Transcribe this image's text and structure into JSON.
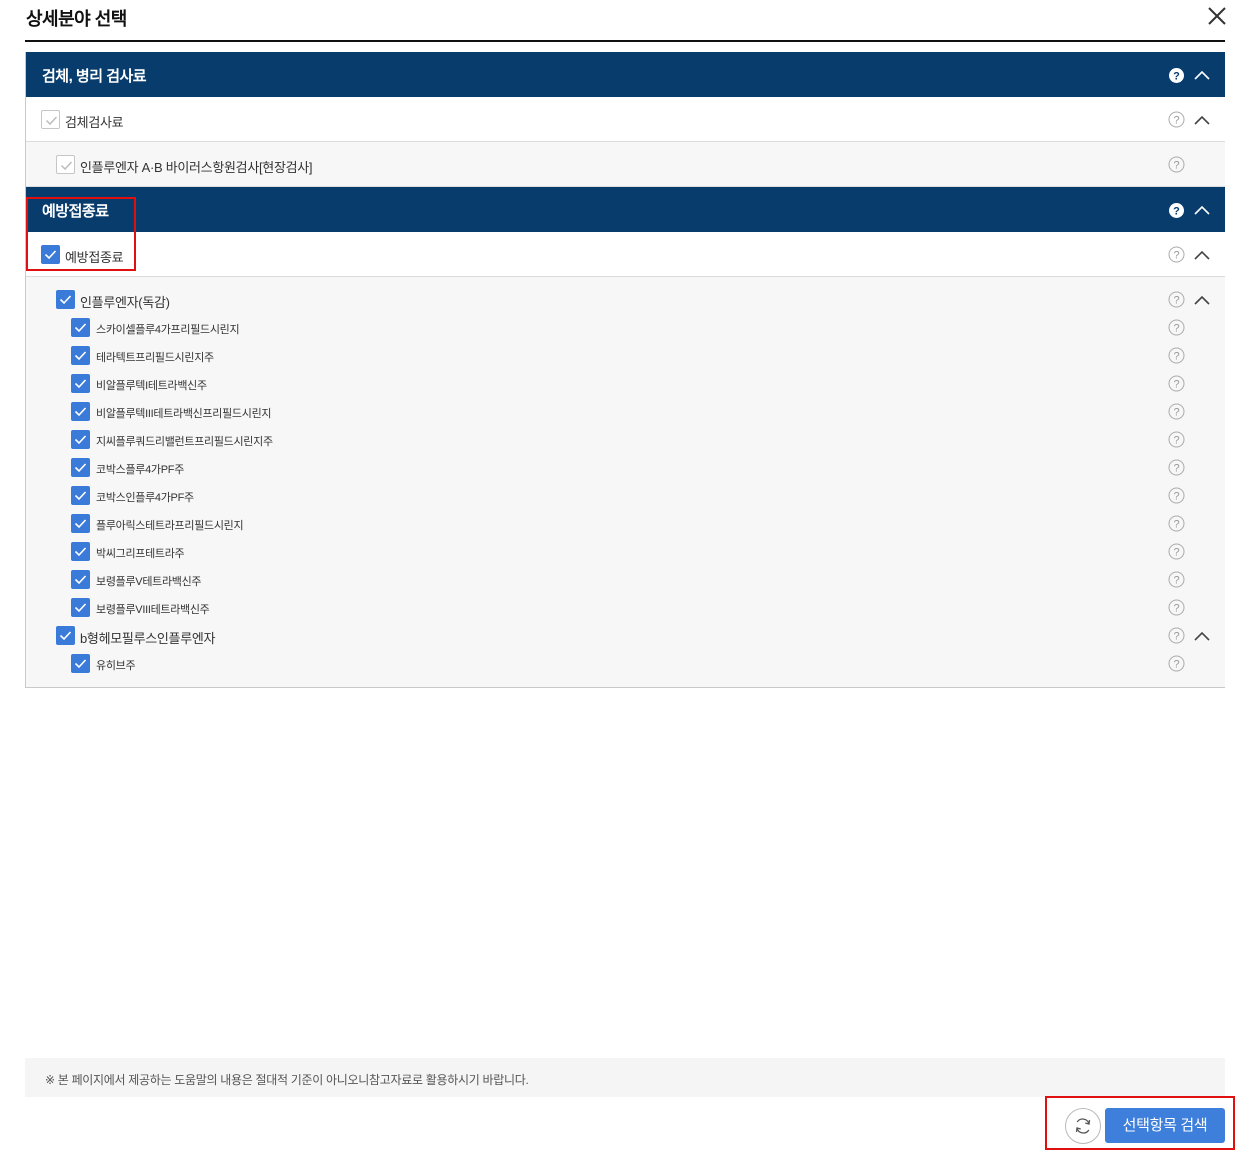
{
  "modal": {
    "title": "상세분야 선택",
    "close_icon": "close-icon"
  },
  "categories": [
    {
      "label": "검체, 병리 검사료",
      "expanded": true,
      "subs": [
        {
          "label": "검체검사료",
          "checked": false,
          "expanded": true,
          "items": [
            {
              "label": "인플루엔자 A·B 바이러스항원검사[현장검사]",
              "checked": false
            }
          ]
        }
      ]
    },
    {
      "label": "예방접종료",
      "expanded": true,
      "subs": [
        {
          "label": "예방접종료",
          "checked": true,
          "expanded": true,
          "groups": [
            {
              "label": "인플루엔자(독감)",
              "checked": true,
              "items": [
                "스카이셀플루4가프리필드시린지",
                "테라텍트프리필드시린지주",
                "비알플루텍I테트라백신주",
                "비알플루텍III테트라백신프리필드시린지",
                "지씨플루쿼드리밸런트프리필드시린지주",
                "코박스플루4가PF주",
                "코박스인플루4가PF주",
                "플루아릭스테트라프리필드시린지",
                "박씨그리프테트라주",
                "보령플루V테트라백신주",
                "보령플루VIII테트라백신주"
              ]
            },
            {
              "label": "b형헤모필루스인플루엔자",
              "checked": true,
              "items": [
                "유히브주"
              ]
            }
          ]
        }
      ]
    }
  ],
  "footer": {
    "notice": "※ 본 페이지에서 제공하는 도움말의 내용은 절대적 기준이 아니오니참고자료로 활용하시기 바랍니다.",
    "refresh_icon": "refresh-icon",
    "search_button": "선택항목 검색"
  },
  "colors": {
    "category_header": "#073c6d",
    "checkbox_checked": "#3a7ad9",
    "search_button": "#3d7fdb",
    "highlight": "#e01010"
  }
}
